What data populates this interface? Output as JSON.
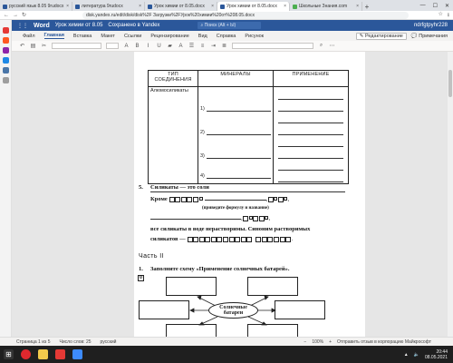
{
  "browser": {
    "tabs": [
      {
        "label": "русский язык 8.05 9rudocx",
        "color": "#2b579a"
      },
      {
        "label": "литература 9rudocx",
        "color": "#2b579a"
      },
      {
        "label": "Урок химии от 8.05.docx",
        "color": "#2b579a"
      },
      {
        "label": "Урок химии от 8.05.docx",
        "color": "#2b579a"
      },
      {
        "label": "Школьные Знания.com",
        "color": "#4caf50"
      }
    ],
    "url": "disk.yandex.ru/edit/disk/disk%2F Загрузки%2FУрок%20химии%20от%208.05.docx"
  },
  "word": {
    "brand": "Word",
    "doc_title": "Урок химии от 8.05",
    "saved": "Сохранено в Yandex",
    "search_placeholder": "Поиск (Alt + Ы)",
    "user": "ndrfgtpyhr228",
    "ribbon_tabs": [
      "Файл",
      "Главная",
      "Вставка",
      "Макет",
      "Ссылки",
      "Рецензирование",
      "Вид",
      "Справка",
      "Рисунок"
    ],
    "edit_mode": "Редактирование",
    "comments": "Примечания"
  },
  "document": {
    "table_headers": [
      "ТИП СОЕДИНЕНИЯ",
      "МИНЕРАЛЫ",
      "ПРИМЕНЕНИЕ"
    ],
    "row_label": "Алюмосиликаты",
    "items": [
      "1)",
      "2)",
      "3)",
      "4)"
    ],
    "q5_num": "5.",
    "q5_line1": "Силикаты — это соли",
    "q5_line2_start": "Кроме",
    "q5_hint": "(приведите формулу и название)",
    "q5_line3": "все силикаты в воде нерастворимы. Синоним растворимых",
    "q5_line4": "силикатов —",
    "part2": "Часть II",
    "q1_num": "1.",
    "q1_text": "Заполните схему «Применение солнечных батарей».",
    "center_label": "Солнечные батареи"
  },
  "status": {
    "page": "Страница 1 из 5",
    "words": "Число слов: 25",
    "lang": "русский",
    "zoom": "100%",
    "feedback": "Отправить отзыв в корпорацию Майкрософт"
  },
  "clock": {
    "time": "20:44",
    "date": "08.05.2021"
  }
}
